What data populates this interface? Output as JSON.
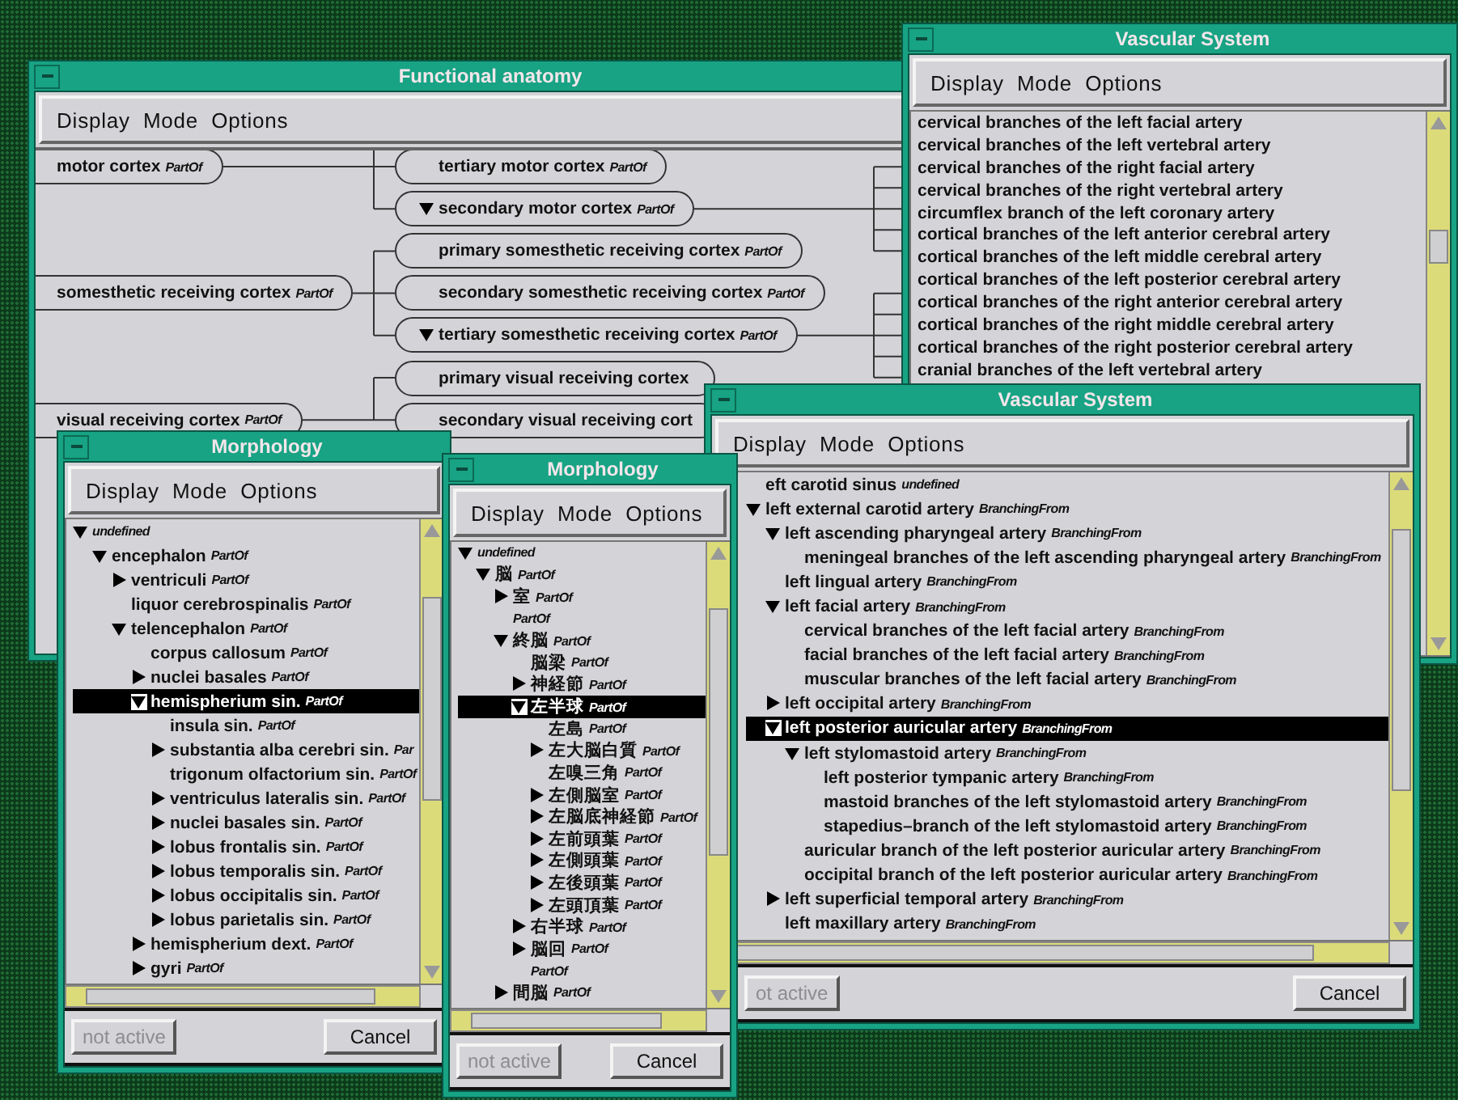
{
  "windows": [
    {
      "title": "Functional anatomy",
      "menus": [
        "Display",
        "Mode",
        "Options"
      ],
      "kind": "diagram",
      "nodes": [
        {
          "label": "motor cortex",
          "relation": "PartOf",
          "expanded": false,
          "children": [
            {
              "label": "tertiary motor cortex",
              "relation": "PartOf",
              "expanded": false
            },
            {
              "label": "secondary motor cortex",
              "relation": "PartOf",
              "expanded": true
            }
          ]
        },
        {
          "label": "somesthetic receiving cortex",
          "relation": "PartOf",
          "expanded": false,
          "children": [
            {
              "label": "primary somesthetic receiving cortex",
              "relation": "PartOf",
              "expanded": false
            },
            {
              "label": "secondary somesthetic receiving cortex",
              "relation": "PartOf",
              "expanded": false
            },
            {
              "label": "tertiary somesthetic receiving cortex",
              "relation": "PartOf",
              "expanded": true
            }
          ]
        },
        {
          "label": "visual receiving cortex",
          "relation": "PartOf",
          "expanded": false,
          "children": [
            {
              "label": "primary visual receiving cortex",
              "expanded": false
            },
            {
              "label": "secondary visual receiving cort",
              "expanded": false
            }
          ]
        }
      ]
    },
    {
      "title": "Vascular System",
      "menus": [
        "Display",
        "Mode",
        "Options"
      ],
      "kind": "list",
      "items": [
        "cervical branches of the left facial artery",
        "cervical branches of the left vertebral artery",
        "cervical branches of the right facial artery",
        "cervical branches of the right vertebral artery",
        "circumflex branch of the left coronary artery",
        "cortical branches of the left anterior cerebral artery",
        "cortical branches of the left middle cerebral artery",
        "cortical branches of the left posterior cerebral artery",
        "cortical branches of the right anterior cerebral artery",
        "cortical branches of the right middle cerebral artery",
        "cortical branches of the right posterior cerebral artery",
        "cranial branches of the left vertebral artery"
      ]
    },
    {
      "title": "Morphology",
      "menus": [
        "Display",
        "Mode",
        "Options"
      ],
      "kind": "tree",
      "tree": [
        {
          "relation": "undefined",
          "expandable": true,
          "expanded": true,
          "selected": false,
          "children": [
            {
              "label": "encephalon",
              "relation": "PartOf",
              "expandable": true,
              "expanded": true,
              "selected": false,
              "children": [
                {
                  "label": "ventriculi",
                  "relation": "PartOf",
                  "expandable": true,
                  "expanded": false,
                  "selected": false
                },
                {
                  "label": "liquor cerebrospinalis",
                  "relation": "PartOf",
                  "expandable": false,
                  "selected": false
                },
                {
                  "label": "telencephalon",
                  "relation": "PartOf",
                  "expandable": true,
                  "expanded": true,
                  "selected": false,
                  "children": [
                    {
                      "label": "corpus callosum",
                      "relation": "PartOf",
                      "expandable": false,
                      "selected": false
                    },
                    {
                      "label": "nuclei basales",
                      "relation": "PartOf",
                      "expandable": true,
                      "expanded": false,
                      "selected": false
                    },
                    {
                      "label": "hemispherium sin.",
                      "relation": "PartOf",
                      "expandable": true,
                      "expanded": true,
                      "selected": true,
                      "children": [
                        {
                          "label": "insula sin.",
                          "relation": "PartOf",
                          "expandable": false,
                          "selected": false
                        },
                        {
                          "label": "substantia alba cerebri sin.",
                          "relation": "Par",
                          "expandable": true,
                          "expanded": false,
                          "selected": false
                        },
                        {
                          "label": "trigonum olfactorium sin.",
                          "relation": "PartOf",
                          "expandable": false,
                          "selected": false
                        },
                        {
                          "label": "ventriculus lateralis sin.",
                          "relation": "PartOf",
                          "expandable": true,
                          "expanded": false,
                          "selected": false
                        },
                        {
                          "label": "nuclei basales sin.",
                          "relation": "PartOf",
                          "expandable": true,
                          "expanded": false,
                          "selected": false
                        },
                        {
                          "label": "lobus frontalis sin.",
                          "relation": "PartOf",
                          "expandable": true,
                          "expanded": false,
                          "selected": false
                        },
                        {
                          "label": "lobus temporalis sin.",
                          "relation": "PartOf",
                          "expandable": true,
                          "expanded": false,
                          "selected": false
                        },
                        {
                          "label": "lobus occipitalis sin.",
                          "relation": "PartOf",
                          "expandable": true,
                          "expanded": false,
                          "selected": false
                        },
                        {
                          "label": "lobus parietalis sin.",
                          "relation": "PartOf",
                          "expandable": true,
                          "expanded": false,
                          "selected": false
                        }
                      ]
                    },
                    {
                      "label": "hemispherium dext.",
                      "relation": "PartOf",
                      "expandable": true,
                      "expanded": false,
                      "selected": false
                    },
                    {
                      "label": "gyri",
                      "relation": "PartOf",
                      "expandable": true,
                      "expanded": false,
                      "selected": false
                    }
                  ]
                }
              ]
            }
          ]
        }
      ],
      "buttons": [
        {
          "label": "not active",
          "disabled": true
        },
        {
          "label": "Cancel",
          "disabled": false
        }
      ]
    },
    {
      "title": "Vascular System",
      "menus": [
        "Display",
        "Mode",
        "Options"
      ],
      "kind": "tree",
      "tree": [
        {
          "label": "eft carotid sinus",
          "relation": "undefined",
          "expandable": false,
          "selected": false
        },
        {
          "label": "left external carotid artery",
          "relation": "BranchingFrom",
          "expandable": true,
          "expanded": true,
          "selected": false,
          "children": [
            {
              "label": "left ascending pharyngeal artery",
              "relation": "BranchingFrom",
              "expandable": true,
              "expanded": true,
              "selected": false,
              "children": [
                {
                  "label": "meningeal branches of the left ascending pharyngeal artery",
                  "relation": "BranchingFrom",
                  "expandable": false,
                  "selected": false
                }
              ]
            },
            {
              "label": "left lingual artery",
              "relation": "BranchingFrom",
              "expandable": false,
              "selected": false
            },
            {
              "label": "left facial artery",
              "relation": "BranchingFrom",
              "expandable": true,
              "expanded": true,
              "selected": false,
              "children": [
                {
                  "label": "cervical branches of the left facial artery",
                  "relation": "BranchingFrom",
                  "expandable": false,
                  "selected": false
                },
                {
                  "label": "facial branches of the left facial artery",
                  "relation": "BranchingFrom",
                  "expandable": false,
                  "selected": false
                },
                {
                  "label": "muscular branches of the left facial artery",
                  "relation": "BranchingFrom",
                  "expandable": false,
                  "selected": false
                }
              ]
            },
            {
              "label": "left occipital artery",
              "relation": "BranchingFrom",
              "expandable": true,
              "expanded": false,
              "selected": false
            },
            {
              "label": "left posterior auricular artery",
              "relation": "BranchingFrom",
              "expandable": true,
              "expanded": true,
              "selected": true,
              "children": [
                {
                  "label": "left stylomastoid artery",
                  "relation": "BranchingFrom",
                  "expandable": true,
                  "expanded": true,
                  "selected": false,
                  "children": [
                    {
                      "label": "left posterior tympanic artery",
                      "relation": "BranchingFrom",
                      "expandable": false,
                      "selected": false
                    },
                    {
                      "label": "mastoid branches of the left stylomastoid artery",
                      "relation": "BranchingFrom",
                      "expandable": false,
                      "selected": false
                    },
                    {
                      "label": "stapedius–branch of the left stylomastoid artery",
                      "relation": "BranchingFrom",
                      "expandable": false,
                      "selected": false
                    }
                  ]
                },
                {
                  "label": "auricular branch of the left posterior auricular artery",
                  "relation": "BranchingFrom",
                  "expandable": false,
                  "selected": false
                },
                {
                  "label": "occipital branch of the left posterior auricular artery",
                  "relation": "BranchingFrom",
                  "expandable": false,
                  "selected": false
                }
              ]
            },
            {
              "label": "left superficial temporal artery",
              "relation": "BranchingFrom",
              "expandable": true,
              "expanded": false,
              "selected": false
            },
            {
              "label": "left maxillary artery",
              "relation": "BranchingFrom",
              "expandable": false,
              "selected": false
            }
          ]
        }
      ],
      "buttons": [
        {
          "label": "ot active",
          "disabled": true
        },
        {
          "label": "Cancel",
          "disabled": false
        }
      ]
    },
    {
      "title": "Morphology",
      "menus": [
        "Display",
        "Mode",
        "Options"
      ],
      "kind": "tree",
      "tree": [
        {
          "relation": "undefined",
          "expandable": true,
          "expanded": true,
          "selected": false,
          "children": [
            {
              "label": "脳",
              "relation": "PartOf",
              "expandable": true,
              "expanded": true,
              "selected": false,
              "children": [
                {
                  "label": "室",
                  "relation": "PartOf",
                  "expandable": true,
                  "expanded": false,
                  "selected": false
                },
                {
                  "relation": "PartOf",
                  "expandable": false,
                  "selected": false
                },
                {
                  "label": "終脳",
                  "relation": "PartOf",
                  "expandable": true,
                  "expanded": true,
                  "selected": false,
                  "children": [
                    {
                      "label": "脳梁",
                      "relation": "PartOf",
                      "expandable": false,
                      "selected": false
                    },
                    {
                      "label": "神経節",
                      "relation": "PartOf",
                      "expandable": true,
                      "expanded": false,
                      "selected": false
                    },
                    {
                      "label": "左半球",
                      "relation": "PartOf",
                      "expandable": true,
                      "expanded": true,
                      "selected": true,
                      "children": [
                        {
                          "label": "左島",
                          "relation": "PartOf",
                          "expandable": false,
                          "selected": false
                        },
                        {
                          "label": "左大脳白質",
                          "relation": "PartOf",
                          "expandable": true,
                          "expanded": false,
                          "selected": false
                        },
                        {
                          "label": "左嗅三角",
                          "relation": "PartOf",
                          "expandable": false,
                          "selected": false
                        },
                        {
                          "label": "左側脳室",
                          "relation": "PartOf",
                          "expandable": true,
                          "expanded": false,
                          "selected": false
                        },
                        {
                          "label": "左脳底神経節",
                          "relation": "PartOf",
                          "expandable": true,
                          "expanded": false,
                          "selected": false
                        },
                        {
                          "label": "左前頭葉",
                          "relation": "PartOf",
                          "expandable": true,
                          "expanded": false,
                          "selected": false
                        },
                        {
                          "label": "左側頭葉",
                          "relation": "PartOf",
                          "expandable": true,
                          "expanded": false,
                          "selected": false
                        },
                        {
                          "label": "左後頭葉",
                          "relation": "PartOf",
                          "expandable": true,
                          "expanded": false,
                          "selected": false
                        },
                        {
                          "label": "左頭頂葉",
                          "relation": "PartOf",
                          "expandable": true,
                          "expanded": false,
                          "selected": false
                        }
                      ]
                    },
                    {
                      "label": "右半球",
                      "relation": "PartOf",
                      "expandable": true,
                      "expanded": false,
                      "selected": false
                    },
                    {
                      "label": "脳回",
                      "relation": "PartOf",
                      "expandable": true,
                      "expanded": false,
                      "selected": false
                    },
                    {
                      "relation": "PartOf",
                      "expandable": false,
                      "selected": false
                    }
                  ]
                },
                {
                  "label": "間脳",
                  "relation": "PartOf",
                  "expandable": true,
                  "expanded": false,
                  "selected": false
                }
              ]
            }
          ]
        }
      ],
      "buttons": [
        {
          "label": "not active",
          "disabled": true
        },
        {
          "label": "Cancel",
          "disabled": false
        }
      ]
    }
  ]
}
